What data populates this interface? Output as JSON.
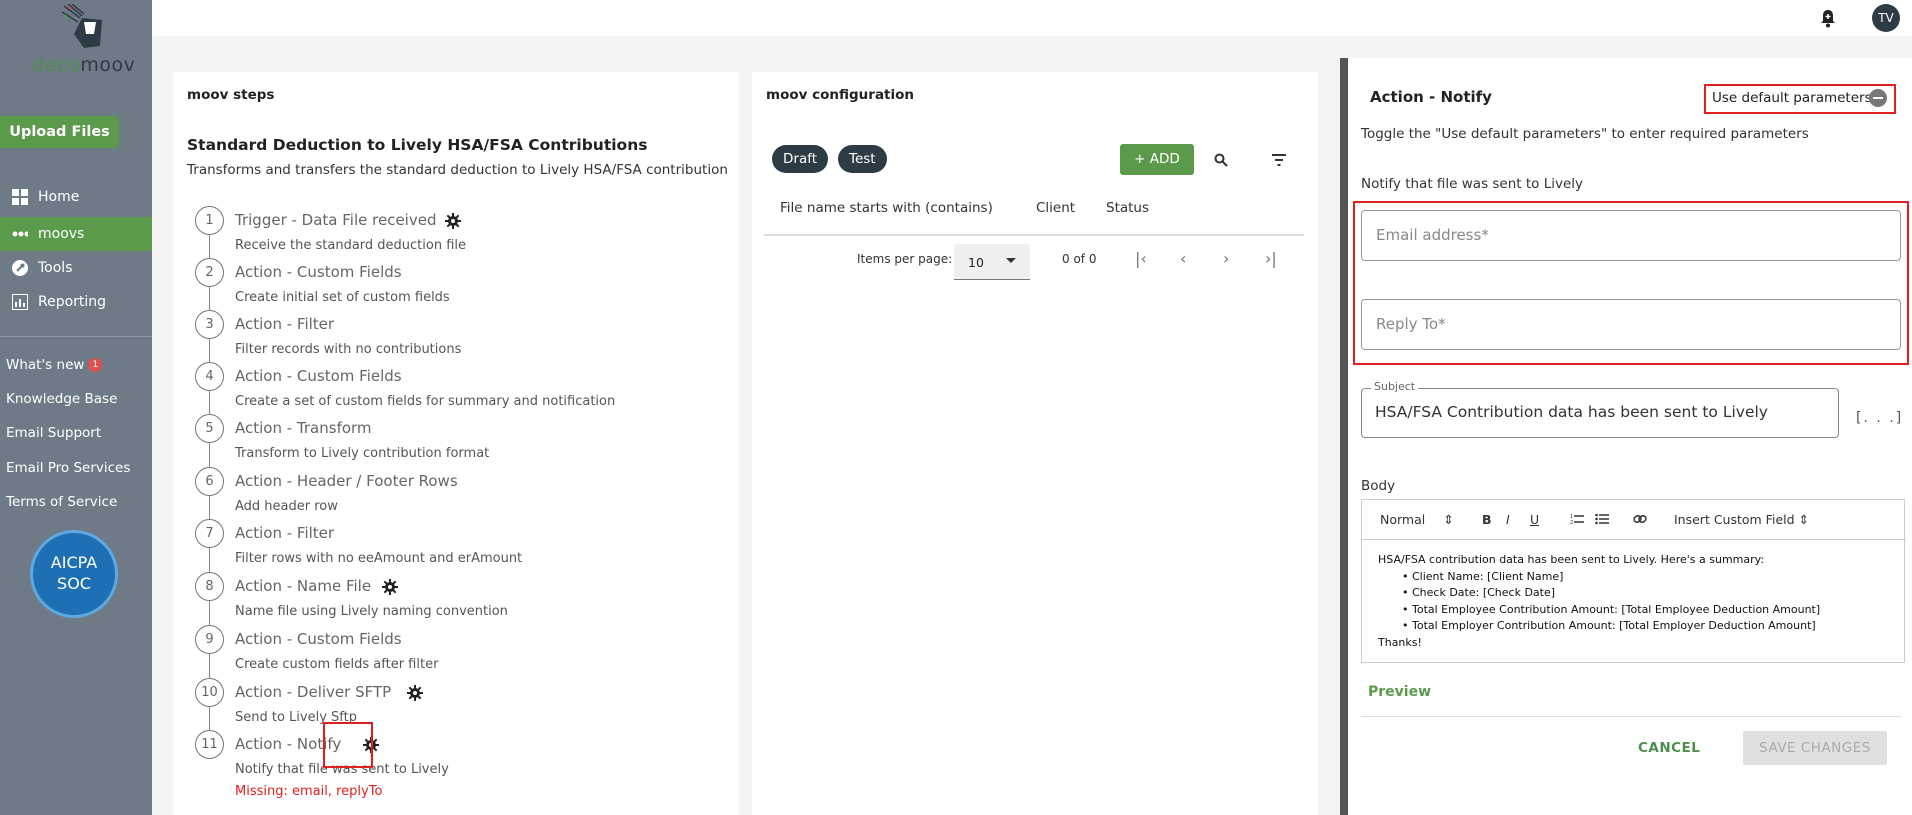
{
  "app": {
    "logo_text_a": "deco",
    "logo_text_b": "moov"
  },
  "sidebar": {
    "upload_label": "Upload Files",
    "nav": [
      {
        "label": "Home",
        "icon": "home-grid-icon"
      },
      {
        "label": "moovs",
        "icon": "moovs-dots-icon"
      },
      {
        "label": "Tools",
        "icon": "wrench-icon"
      },
      {
        "label": "Reporting",
        "icon": "chart-icon"
      }
    ],
    "links": [
      {
        "label": "What's new",
        "badge": "1"
      },
      {
        "label": "Knowledge Base"
      },
      {
        "label": "Email Support"
      },
      {
        "label": "Email Pro Services"
      },
      {
        "label": "Terms of Service"
      }
    ],
    "cert": {
      "line1": "AICPA",
      "line2": "SOC"
    }
  },
  "topbar": {
    "avatar": "TV"
  },
  "steps_panel": {
    "title": "moov steps",
    "moov_title": "Standard Deduction to Lively HSA/FSA Contributions",
    "moov_desc": "Transforms and transfers the standard deduction to Lively HSA/FSA contribution",
    "steps": [
      {
        "n": "1",
        "name": "Trigger - Data File received",
        "desc": "Receive the standard deduction file",
        "gear": true
      },
      {
        "n": "2",
        "name": "Action - Custom Fields",
        "desc": "Create initial set of custom fields",
        "gear": false
      },
      {
        "n": "3",
        "name": "Action - Filter",
        "desc": "Filter records with no contributions",
        "gear": false
      },
      {
        "n": "4",
        "name": "Action - Custom Fields",
        "desc": "Create a set of custom fields for summary and notification",
        "gear": false
      },
      {
        "n": "5",
        "name": "Action - Transform",
        "desc": "Transform to Lively contribution format",
        "gear": false
      },
      {
        "n": "6",
        "name": "Action - Header / Footer Rows",
        "desc": "Add header row",
        "gear": false
      },
      {
        "n": "7",
        "name": "Action - Filter",
        "desc": "Filter rows with no eeAmount and erAmount",
        "gear": false
      },
      {
        "n": "8",
        "name": "Action - Name File",
        "desc": "Name file using Lively naming convention",
        "gear": true
      },
      {
        "n": "9",
        "name": "Action - Custom Fields",
        "desc": "Create custom fields after filter",
        "gear": false
      },
      {
        "n": "10",
        "name": "Action - Deliver SFTP",
        "desc": "Send to Lively Sftp",
        "gear": true
      },
      {
        "n": "11",
        "name": "Action - Notify",
        "desc": "Notify that file was sent to Lively",
        "gear": true
      }
    ],
    "missing": "Missing: email, replyTo"
  },
  "config_panel": {
    "title": "moov configuration",
    "chips": [
      "Draft",
      "Test"
    ],
    "add_label": "+ ADD",
    "columns": [
      "File name starts with (contains)",
      "Client",
      "Status"
    ],
    "items_per_page_label": "Items per page:",
    "items_per_page": "10",
    "range": "0 of 0"
  },
  "action_panel": {
    "title": "Action - Notify",
    "toggle_label": "Use default parameters",
    "hint": "Toggle the \"Use default parameters\" to enter required parameters",
    "section": "Notify that file was sent to Lively",
    "email_placeholder": "Email address*",
    "reply_placeholder": "Reply To*",
    "subject_label": "Subject",
    "subject_value": "HSA/FSA Contribution data has been sent to Lively",
    "more": "[. . .]",
    "body_label": "Body",
    "editor": {
      "format": "Normal",
      "bold": "B",
      "italic": "I",
      "underline": "U",
      "insert_field": "Insert Custom Field",
      "intro": "HSA/FSA contribution data has been sent to Lively. Here's a summary:",
      "items": [
        "Client Name: [Client Name]",
        "Check Date: [Check Date]",
        "Total Employee Contribution Amount: [Total Employee Deduction Amount]",
        "Total Employer Contribution Amount: [Total Employer Deduction Amount]"
      ],
      "outro": "Thanks!"
    },
    "preview_label": "Preview",
    "cancel_label": "CANCEL",
    "save_label": "SAVE CHANGES"
  }
}
